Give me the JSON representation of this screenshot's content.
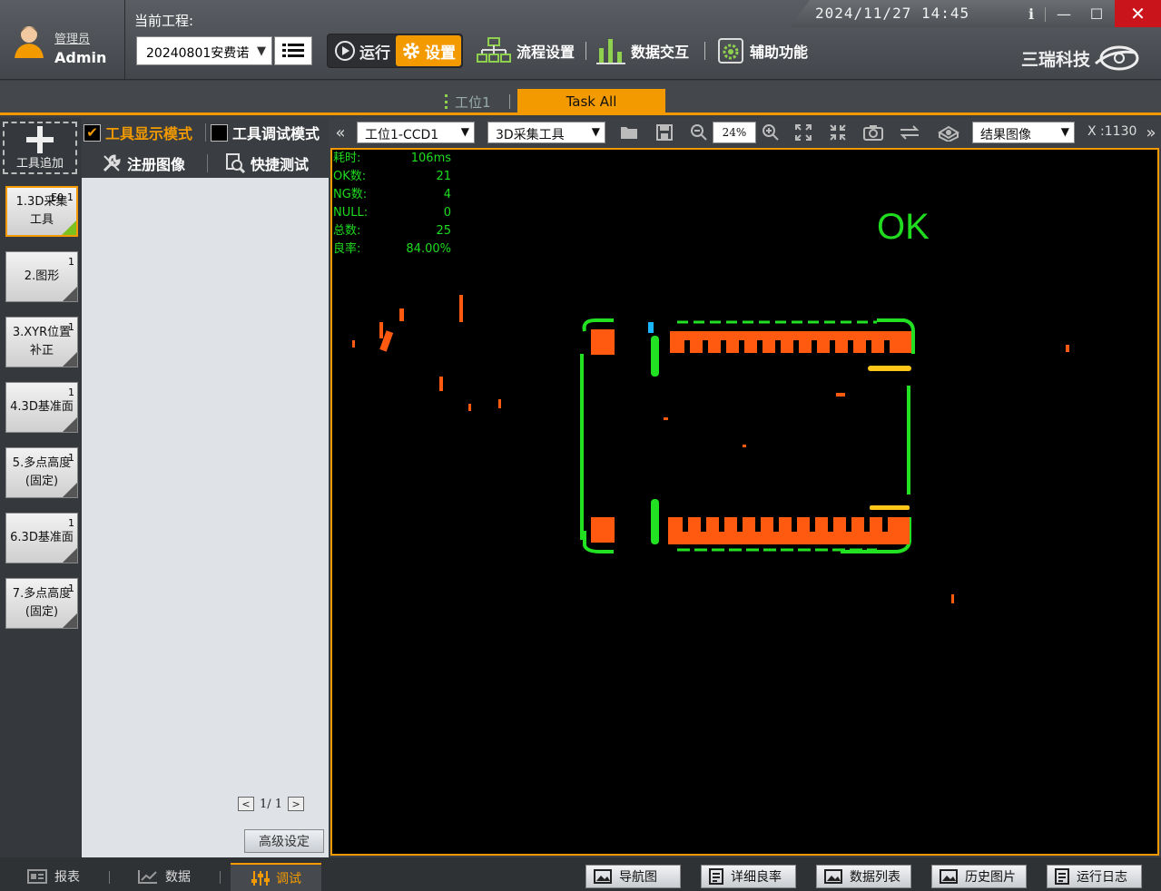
{
  "user": {
    "role": "管理员",
    "name": "Admin"
  },
  "project": {
    "label": "当前工程:",
    "current": "20240801安费诺"
  },
  "modes": {
    "run": "运行",
    "settings": "设置"
  },
  "nav": {
    "flow": "流程设置",
    "data_exchange": "数据交互",
    "aux": "辅助功能"
  },
  "clock": "2024/11/27  14:45",
  "brand": "三瑞科技",
  "stations": {
    "tab1": "工位1",
    "tab2": "Task All"
  },
  "toolbar_left": {
    "add_tool": "工具追加",
    "display_mode": "工具显示模式",
    "debug_mode": "工具调试模式",
    "register_image": "注册图像",
    "quick_test": "快捷测试"
  },
  "tools": [
    {
      "label": "1.3D采集工具",
      "count": "E0-1"
    },
    {
      "label": "2.图形",
      "count": "1"
    },
    {
      "label": "3.XYR位置补正",
      "count": "1"
    },
    {
      "label": "4.3D基准面",
      "count": "1"
    },
    {
      "label": "5.多点高度(固定)",
      "count": "1"
    },
    {
      "label": "6.3D基准面",
      "count": "1"
    },
    {
      "label": "7.多点高度(固定)",
      "count": "1"
    }
  ],
  "pager": {
    "text": "1/ 1",
    "prev": "<",
    "next": ">"
  },
  "advanced_button": "高级设定",
  "image_toolbar": {
    "camera": "工位1-CCD1",
    "tool": "3D采集工具",
    "zoom": "24%",
    "view_mode": "结果图像",
    "coord": "X :1130",
    "collapse": "«",
    "expand": "»"
  },
  "stats": [
    {
      "k": "耗时:",
      "v": "106ms"
    },
    {
      "k": "OK数:",
      "v": "21"
    },
    {
      "k": "NG数:",
      "v": "4"
    },
    {
      "k": "NULL:",
      "v": "0"
    },
    {
      "k": "总数:",
      "v": "25"
    },
    {
      "k": "良率:",
      "v": "84.00%"
    }
  ],
  "result": "OK",
  "bottom_tabs": {
    "report": "报表",
    "data": "数据",
    "debug": "调试"
  },
  "bottom_buttons": {
    "nav": "导航图",
    "yield": "详细良率",
    "list": "数据列表",
    "history": "历史图片",
    "log": "运行日志"
  },
  "colors": {
    "accent": "#f39a00",
    "ok": "#1fdc1f",
    "close": "#c8141a"
  }
}
